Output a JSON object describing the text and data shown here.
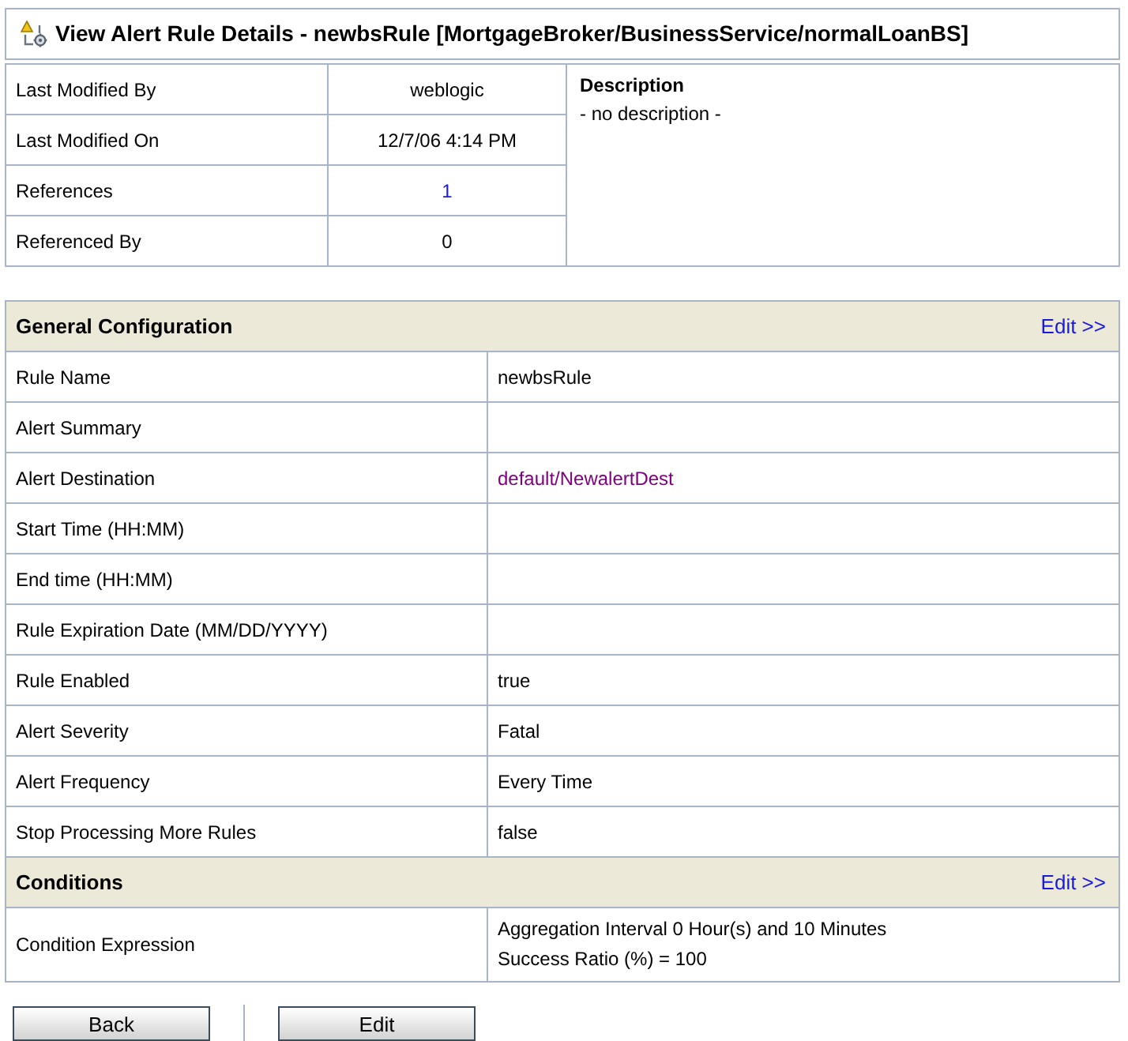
{
  "page": {
    "title": "View Alert Rule Details - newbsRule [MortgageBroker/BusinessService/normalLoanBS]"
  },
  "summary": {
    "rows": [
      {
        "label": "Last Modified By",
        "kind": "text",
        "value": "weblogic"
      },
      {
        "label": "Last Modified On",
        "kind": "text",
        "value": "12/7/06 4:14 PM"
      },
      {
        "label": "References",
        "kind": "link",
        "value": "1"
      },
      {
        "label": "Referenced By",
        "kind": "text",
        "value": "0"
      }
    ],
    "description": {
      "heading": "Description",
      "text": "- no description -"
    }
  },
  "sections": [
    {
      "title": "General Configuration",
      "edit_link": "Edit >>",
      "rows": [
        {
          "label": "Rule Name",
          "kind": "text",
          "value": "newbsRule"
        },
        {
          "label": "Alert Summary",
          "kind": "text"
        },
        {
          "label": "Alert Destination",
          "kind": "visited_link",
          "value": "default/NewalertDest"
        },
        {
          "label": "Start Time (HH:MM)",
          "kind": "text"
        },
        {
          "label": "End time (HH:MM)",
          "kind": "text"
        },
        {
          "label": "Rule Expiration Date (MM/DD/YYYY)",
          "kind": "text"
        },
        {
          "label": "Rule Enabled",
          "kind": "text",
          "value": "true"
        },
        {
          "label": "Alert Severity",
          "kind": "text",
          "value": "Fatal"
        },
        {
          "label": "Alert Frequency",
          "kind": "text",
          "value": "Every Time"
        },
        {
          "label": "Stop Processing More Rules",
          "kind": "text",
          "value": "false"
        }
      ]
    },
    {
      "title": "Conditions",
      "edit_link": "Edit >>",
      "rows": [
        {
          "label": "Condition Expression",
          "kind": "multiline",
          "lines": [
            "Aggregation Interval 0 Hour(s) and 10 Minutes",
            "Success Ratio (%) = 100"
          ]
        }
      ]
    }
  ],
  "buttons": [
    "Back",
    "Edit"
  ]
}
